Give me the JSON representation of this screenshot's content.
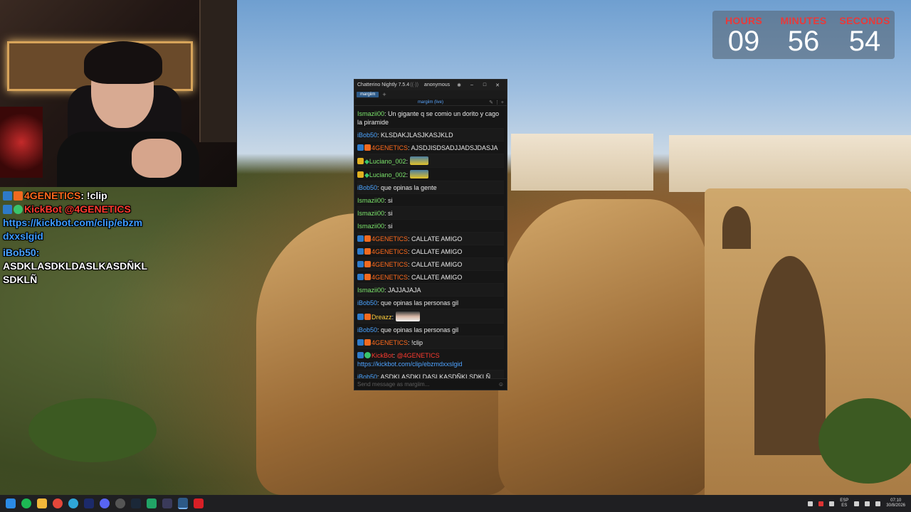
{
  "webcam": {
    "label": "webcam-feed"
  },
  "overlay": {
    "lines": [
      {
        "user": "4GENETICS",
        "sep": ":",
        "text": "!clip"
      },
      {
        "user": "KickBot",
        "text": "@4GENETICS",
        "link": "https://kickbot.com/clip/ebzm",
        "link2": "dxxslgid"
      },
      {
        "user": "iBob50",
        "sep": ":",
        "text": "ASDKLASDKLDASLKASDÑKL",
        "text2": "SDKLÑ"
      }
    ]
  },
  "timer": {
    "hours_label": "HOURS",
    "hours": "09",
    "minutes_label": "MINUTES",
    "minutes": "56",
    "seconds_label": "SECONDS",
    "seconds": "54"
  },
  "chatterino": {
    "title": "Chatterino Nightly 7.5.4",
    "account": "anonymous",
    "tab": "margiim",
    "channel_header": "margiim (live)",
    "input_placeholder": "Send message as margiim...",
    "messages": [
      {
        "user": "Ismazii00",
        "text": "Un gigante q se comio un dorito y cago la piramide"
      },
      {
        "user": "iBob50",
        "text": "KLSDAKJLASJKASJKLD"
      },
      {
        "user": "4GENETICS",
        "text": "AJSDJISDSADJJADSJDASJA"
      },
      {
        "user": "Luciano_002",
        "text": ""
      },
      {
        "user": "Luciano_002",
        "text": ""
      },
      {
        "user": "iBob50",
        "text": "que opinas la gente"
      },
      {
        "user": "Ismazii00",
        "text": "si"
      },
      {
        "user": "Ismazii00",
        "text": "si"
      },
      {
        "user": "Ismazii00",
        "text": "si"
      },
      {
        "user": "4GENETICS",
        "text": "CALLATE AMIGO"
      },
      {
        "user": "4GENETICS",
        "text": "CALLATE AMIGO"
      },
      {
        "user": "4GENETICS",
        "text": "CALLATE AMIGO"
      },
      {
        "user": "4GENETICS",
        "text": "CALLATE AMIGO"
      },
      {
        "user": "Ismazii00",
        "text": "JAJJAJAJA"
      },
      {
        "user": "iBob50",
        "text": "que opinas las personas gil"
      },
      {
        "user": "Dreazz",
        "text": ""
      },
      {
        "user": "iBob50",
        "text": "que opinas las personas gil"
      },
      {
        "user": "4GENETICS",
        "text": "!clip"
      },
      {
        "user": "KickBot",
        "text": "@4GENETICS",
        "link": "https://kickbot.com/clip/ebzmdxxslgid"
      },
      {
        "user": "iBob50",
        "text": "ASDKLASDKLDASLKASDÑKLSDKLÑ"
      }
    ]
  },
  "taskbar": {
    "lang_top": "ESP",
    "lang_bottom": "ES",
    "time": "07:10",
    "date": "30/8/2026"
  },
  "colors": {
    "accent": "#e83a3a",
    "link": "#4ea3ff",
    "tab": "#2d5a88"
  }
}
